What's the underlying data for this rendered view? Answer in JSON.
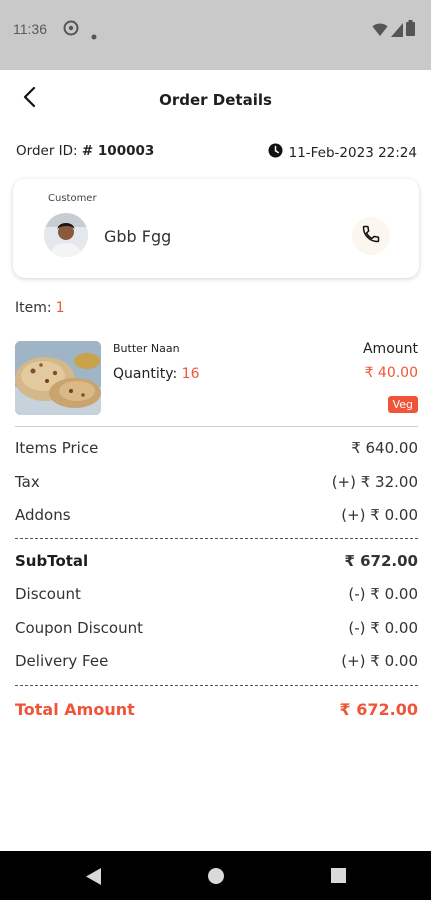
{
  "status_bar": {
    "time": "11:36"
  },
  "header": {
    "title": "Order Details"
  },
  "order": {
    "id_label": "Order ID:",
    "id_value": "# 100003",
    "datetime": "11-Feb-2023 22:24"
  },
  "customer": {
    "label": "Customer",
    "name": "Gbb Fgg"
  },
  "items_summary": {
    "label": "Item:",
    "count": "1"
  },
  "item": {
    "name": "Butter Naan",
    "quantity_label": "Quantity:",
    "quantity": "16",
    "amount_label": "Amount",
    "amount": "₹ 40.00",
    "badge": "Veg"
  },
  "breakdown": {
    "items_price_label": "Items Price",
    "items_price": "₹ 640.00",
    "tax_label": "Tax",
    "tax": "(+) ₹ 32.00",
    "addons_label": "Addons",
    "addons": "(+) ₹ 0.00",
    "subtotal_label": "SubTotal",
    "subtotal": "₹ 672.00",
    "discount_label": "Discount",
    "discount": "(-) ₹ 0.00",
    "coupon_label": "Coupon Discount",
    "coupon": "(-) ₹ 0.00",
    "delivery_label": "Delivery Fee",
    "delivery": "(+) ₹ 0.00",
    "total_label": "Total Amount",
    "total": "₹ 672.00"
  },
  "colors": {
    "accent": "#f0553a",
    "status_bar": "#c9c9c9",
    "nav_bar": "#000000"
  },
  "icons": {
    "status": [
      "do-not-disturb-icon",
      "dot-icon",
      "wifi-icon",
      "signal-icon",
      "battery-icon"
    ],
    "back": "arrow-back-icon",
    "clock": "clock-icon",
    "call": "phone-icon",
    "nav": [
      "nav-back-icon",
      "nav-home-icon",
      "nav-recents-icon"
    ]
  }
}
